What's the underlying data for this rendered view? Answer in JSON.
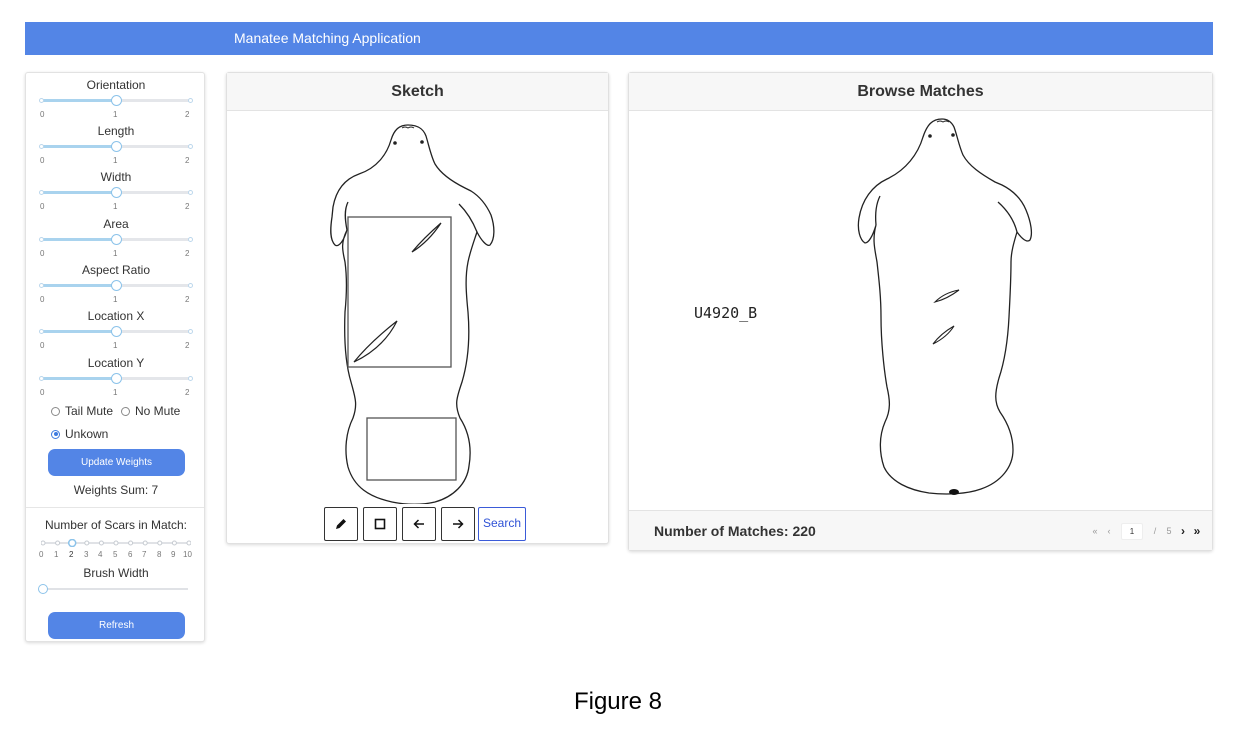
{
  "app": {
    "title": "Manatee Matching Application",
    "accent_color": "#5385e6"
  },
  "sidebar": {
    "sliders": [
      {
        "label": "Orientation",
        "min": "0",
        "mid": "1",
        "max": "2",
        "value": 1
      },
      {
        "label": "Length",
        "min": "0",
        "mid": "1",
        "max": "2",
        "value": 1
      },
      {
        "label": "Width",
        "min": "0",
        "mid": "1",
        "max": "2",
        "value": 1
      },
      {
        "label": "Area",
        "min": "0",
        "mid": "1",
        "max": "2",
        "value": 1
      },
      {
        "label": "Aspect Ratio",
        "min": "0",
        "mid": "1",
        "max": "2",
        "value": 1
      },
      {
        "label": "Location X",
        "min": "0",
        "mid": "1",
        "max": "2",
        "value": 1
      },
      {
        "label": "Location Y",
        "min": "0",
        "mid": "1",
        "max": "2",
        "value": 1
      }
    ],
    "mute_options": [
      {
        "label": "Tail Mute",
        "checked": false
      },
      {
        "label": "No Mute",
        "checked": false
      },
      {
        "label": "Unkown",
        "checked": true
      }
    ],
    "update_button": "Update Weights",
    "weights_sum": "Weights Sum: 7",
    "scars_label": "Number of Scars in Match:",
    "scar_ticks": [
      "0",
      "1",
      "2",
      "3",
      "4",
      "5",
      "6",
      "7",
      "8",
      "9",
      "10"
    ],
    "scar_value": 2,
    "brush_label": "Brush Width",
    "brush_value_fraction": 0,
    "refresh_button": "Refresh"
  },
  "sketch": {
    "header": "Sketch",
    "tools": {
      "pencil_icon": "pencil-icon",
      "rectangle_icon": "square-icon",
      "undo_icon": "arrow-left-icon",
      "redo_icon": "arrow-right-icon"
    },
    "search_button": "Search"
  },
  "matches": {
    "header": "Browse Matches",
    "match_id": "U4920_B",
    "count_label": "Number of Matches: 220",
    "pager": {
      "first": "«",
      "prev": "‹",
      "page": "1",
      "separator": "/",
      "total": "5",
      "next": "›",
      "last": "»"
    }
  },
  "figure_caption": "Figure 8"
}
